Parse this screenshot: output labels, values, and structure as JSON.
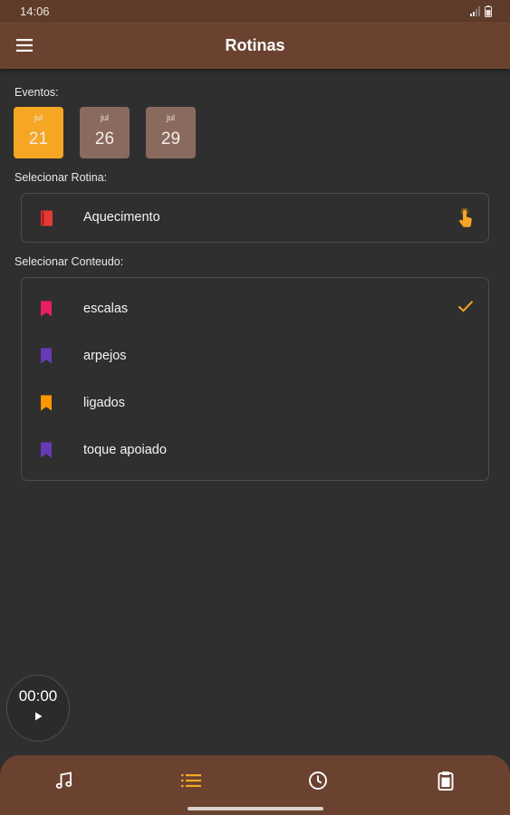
{
  "status_bar": {
    "time": "14:06",
    "icons": [
      "signal-icon",
      "battery-icon"
    ]
  },
  "app_bar": {
    "title": "Rotinas",
    "menu_icon": "menu-icon",
    "color": "#6b4230"
  },
  "events": {
    "label": "Eventos:",
    "items": [
      {
        "month": "jul",
        "day": "21",
        "selected": true
      },
      {
        "month": "jul",
        "day": "26",
        "selected": false
      },
      {
        "month": "jul",
        "day": "29",
        "selected": false
      }
    ],
    "selected_color": "#f5a623",
    "default_color": "#8a6a5e"
  },
  "routine": {
    "label": "Selecionar Rotina:",
    "selected": {
      "name": "Aquecimento",
      "icon": "book-icon",
      "icon_color": "#e53935",
      "action_icon": "touch-icon"
    }
  },
  "content": {
    "label": "Selecionar Conteudo:",
    "items": [
      {
        "name": "escalas",
        "icon": "bookmark-icon",
        "icon_color": "#e91e63",
        "checked": true
      },
      {
        "name": "arpejos",
        "icon": "bookmark-icon",
        "icon_color": "#673ab7",
        "checked": false
      },
      {
        "name": "ligados",
        "icon": "bookmark-icon",
        "icon_color": "#ff9800",
        "checked": false
      },
      {
        "name": "toque apoiado",
        "icon": "bookmark-icon",
        "icon_color": "#673ab7",
        "checked": false
      }
    ]
  },
  "timer": {
    "time": "00:00",
    "icon": "play-icon"
  },
  "bottom_nav": {
    "items": [
      {
        "icon": "music-note-icon",
        "active": false
      },
      {
        "icon": "list-icon",
        "active": true
      },
      {
        "icon": "clock-icon",
        "active": false
      },
      {
        "icon": "clipboard-icon",
        "active": false
      }
    ],
    "active_color": "#f5a623",
    "inactive_color": "#ffffff"
  },
  "colors": {
    "background": "#2f2f2f",
    "accent": "#f5a623",
    "brown": "#6b4230"
  }
}
